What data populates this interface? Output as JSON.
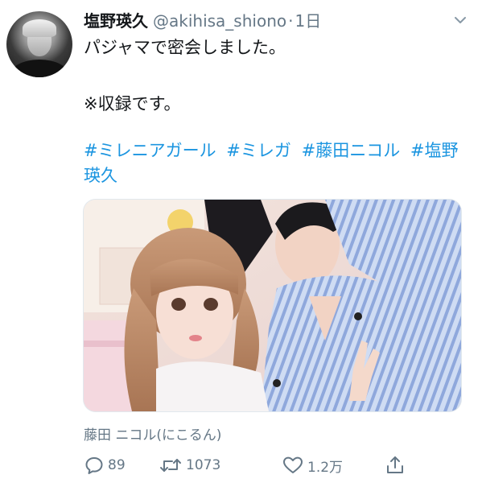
{
  "author": {
    "display_name": "塩野瑛久",
    "handle": "@akihisa_shiono",
    "separator": "·",
    "time": "1日"
  },
  "tweet": {
    "line1": "パジャマで密会しました。",
    "line2": "※収録です。",
    "hashtags": [
      "#ミレニアガール",
      "#ミレガ",
      "#藤田ニコル",
      "#塩野瑛久"
    ]
  },
  "media": {
    "caption": "藤田 ニコル(にこるん)"
  },
  "actions": {
    "reply_count": "89",
    "retweet_count": "1073",
    "like_count": "1.2万"
  },
  "colors": {
    "link": "#1b95e0",
    "secondary": "#657786",
    "text": "#14171a"
  },
  "icons": {
    "menu": "chevron-down-icon",
    "reply": "reply-icon",
    "retweet": "retweet-icon",
    "like": "heart-icon",
    "share": "share-icon"
  }
}
